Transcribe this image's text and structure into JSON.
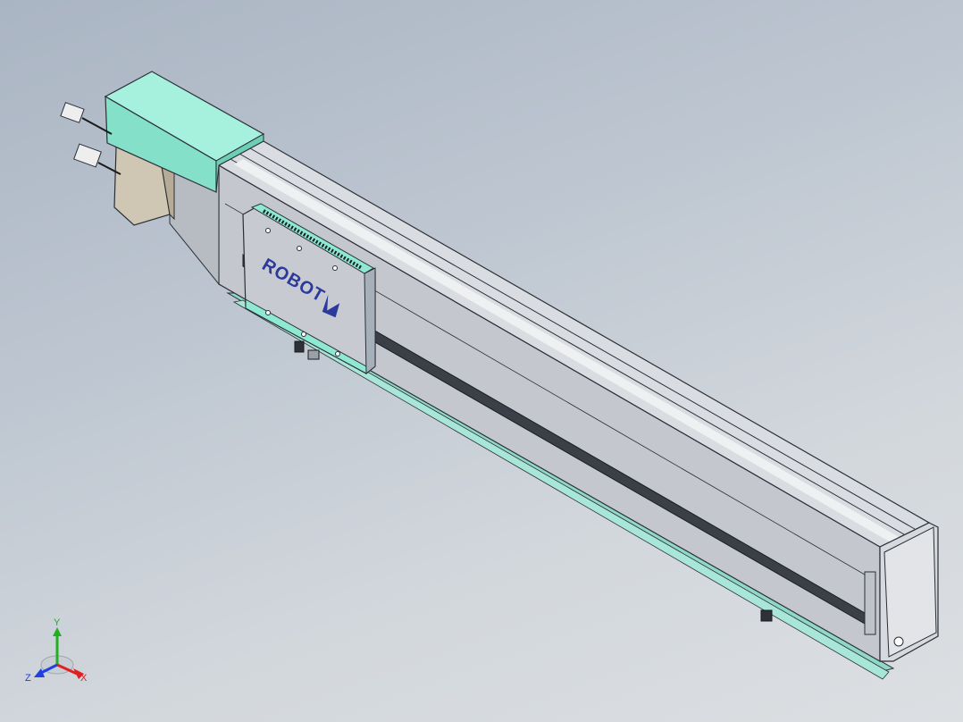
{
  "model": {
    "logo_text": "ROBOT"
  },
  "triad": {
    "x_label": "X",
    "y_label": "Y",
    "z_label": "Z"
  },
  "colors": {
    "background_top": "#aab5c3",
    "background_bottom": "#dcdfe2",
    "motor_cover": "#8ee8d2",
    "profile": "#c9ccd1",
    "edge": "#2b2f36",
    "logo": "#2b3a9c",
    "axis_x": "#e02020",
    "axis_y": "#20b020",
    "axis_z": "#2040e0"
  }
}
